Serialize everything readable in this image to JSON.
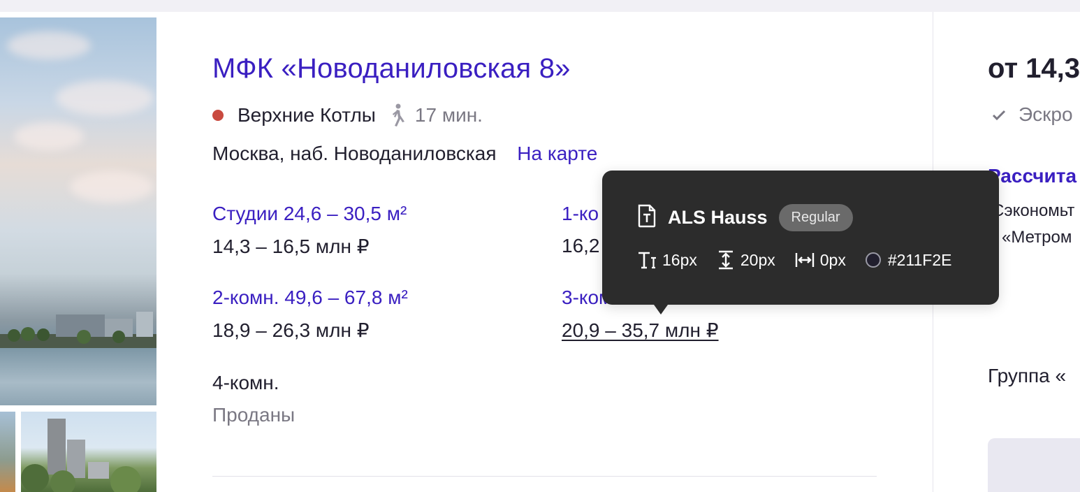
{
  "complex": {
    "title": "МФК «Новоданиловская 8»",
    "metro": "Верхние Котлы",
    "walk_time": "17 мин.",
    "address": "Москва, наб. Новоданиловская",
    "map_link": "На карте"
  },
  "units": [
    {
      "name": "Студии 24,6 – 30,5 м²",
      "price": "14,3 – 16,5 млн ₽"
    },
    {
      "name": "1-ко",
      "price": "16,2"
    },
    {
      "name": "2-комн. 49,6 – 67,8 м²",
      "price": "18,9 – 26,3 млн ₽"
    },
    {
      "name": "3-комн.",
      "price": "20,9 – 35,7 млн ₽"
    },
    {
      "name": "4-комн.",
      "price": "Проданы"
    }
  ],
  "right": {
    "price": "от 14,3",
    "escrow": "Эскро",
    "calc": "Рассчита",
    "line1": "Сэкономьт",
    "line2": "«Метром",
    "group": "Группа «"
  },
  "tooltip": {
    "font_name": "ALS Hauss",
    "weight": "Regular",
    "size": "16px",
    "line_height": "20px",
    "letter_spacing": "0px",
    "color": "#211F2E"
  },
  "colors": {
    "accent": "#3a1fc1",
    "text": "#211F2E",
    "muted": "#7a7883",
    "metro_line": "#c94a3f",
    "tooltip_bg": "#2c2c2c"
  }
}
